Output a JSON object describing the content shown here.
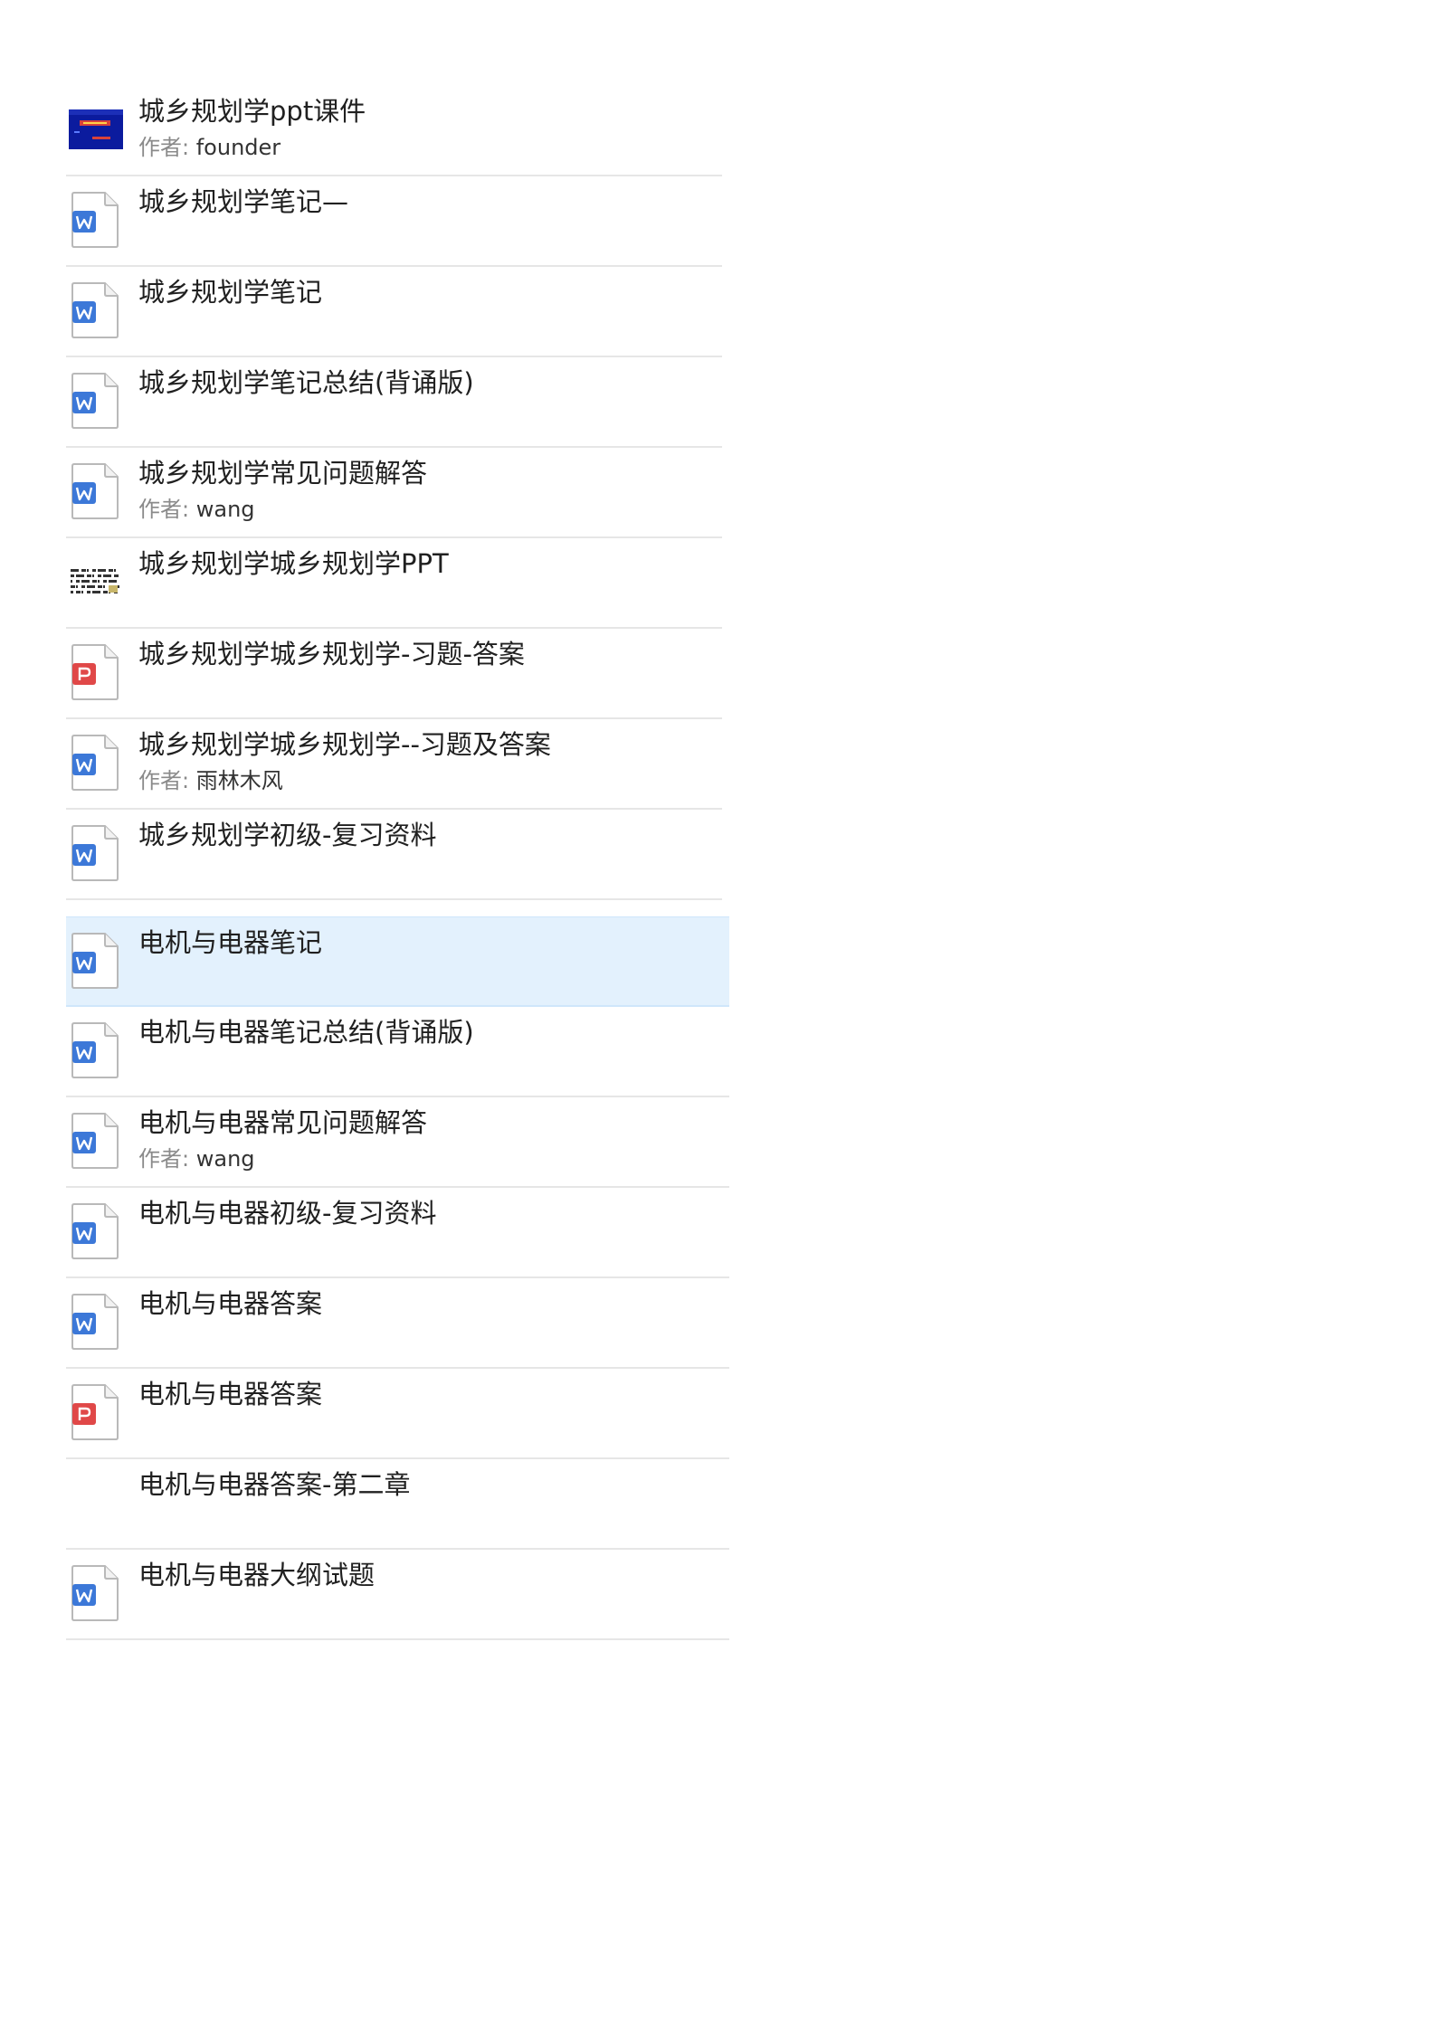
{
  "author_label": "作者:",
  "colors": {
    "word_blue": "#3c78d8",
    "pdf_red": "#e04848",
    "selected_bg": "#e3f1fd",
    "divider": "#e6e6e6"
  },
  "group_a": [
    {
      "title": "城乡规划学ppt课件",
      "author": "founder",
      "icon": "ppt-thumbnail-icon"
    },
    {
      "title": "城乡规划学笔记—",
      "icon": "word-doc-icon"
    },
    {
      "title": "城乡规划学笔记",
      "icon": "word-doc-icon"
    },
    {
      "title": "城乡规划学笔记总结(背诵版)",
      "icon": "word-doc-icon"
    },
    {
      "title": "城乡规划学常见问题解答",
      "author": "wang",
      "icon": "word-doc-icon"
    },
    {
      "title": "城乡规划学城乡规划学PPT",
      "icon": "image-thumbnail-icon"
    },
    {
      "title": "城乡规划学城乡规划学-习题-答案",
      "icon": "pdf-doc-icon"
    },
    {
      "title": "城乡规划学城乡规划学--习题及答案",
      "author": "雨林木风",
      "icon": "word-doc-icon"
    },
    {
      "title": "城乡规划学初级-复习资料",
      "icon": "word-doc-icon"
    }
  ],
  "group_b": [
    {
      "title": "电机与电器笔记",
      "icon": "word-doc-icon",
      "selected": true
    },
    {
      "title": "电机与电器笔记总结(背诵版)",
      "icon": "word-doc-icon"
    },
    {
      "title": "电机与电器常见问题解答",
      "author": "wang",
      "icon": "word-doc-icon"
    },
    {
      "title": "电机与电器初级-复习资料",
      "icon": "word-doc-icon"
    },
    {
      "title": "电机与电器答案",
      "icon": "word-doc-icon"
    },
    {
      "title": "电机与电器答案",
      "icon": "pdf-doc-icon"
    },
    {
      "title": "电机与电器答案-第二章",
      "icon": ""
    },
    {
      "title": "电机与电器大纲试题",
      "icon": "word-doc-icon"
    }
  ]
}
